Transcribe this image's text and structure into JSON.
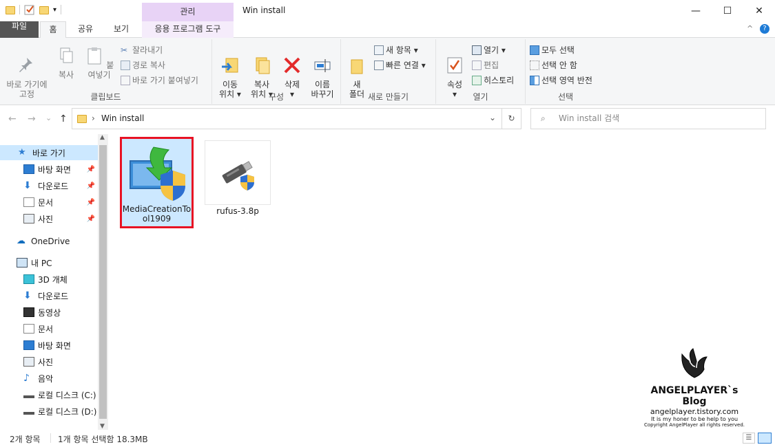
{
  "window": {
    "title": "Win install",
    "context_tab": "관리",
    "minimize": "—",
    "maximize": "☐",
    "close": "✕"
  },
  "tabs": {
    "file": "파일",
    "home": "홈",
    "share": "공유",
    "view": "보기",
    "app_tools": "응용 프로그램 도구"
  },
  "ribbon": {
    "clipboard": {
      "label": "클립보드",
      "pin": "바로 가기에\n고정",
      "copy": "복사",
      "paste": "붙여넣기",
      "cut": "잘라내기",
      "copy_path": "경로 복사",
      "paste_shortcut": "바로 가기 붙여넣기"
    },
    "organize": {
      "label": "구성",
      "move": "이동\n위치 ▾",
      "copy_to": "복사\n위치 ▾",
      "delete": "삭제\n▾",
      "rename": "이름\n바꾸기"
    },
    "new": {
      "label": "새로 만들기",
      "new_folder": "새\n폴더",
      "new_item": "새 항목 ▾",
      "easy_access": "빠른 연결 ▾"
    },
    "open": {
      "label": "열기",
      "properties": "속성\n▾",
      "open": "열기 ▾",
      "edit": "편집",
      "history": "히스토리"
    },
    "select": {
      "label": "선택",
      "select_all": "모두 선택",
      "select_none": "선택 안 함",
      "invert": "선택 영역 반전"
    }
  },
  "address": {
    "back": "←",
    "forward": "→",
    "recent": "⌄",
    "up": "↑",
    "path": "Win install",
    "refresh": "↻",
    "search_placeholder": "Win install 검색"
  },
  "nav": {
    "quick_access": "바로 가기",
    "quick_items": [
      "바탕 화면",
      "다운로드",
      "문서",
      "사진"
    ],
    "onedrive": "OneDrive",
    "this_pc": "내 PC",
    "pc_items": [
      "3D 개체",
      "다운로드",
      "동영상",
      "문서",
      "바탕 화면",
      "사진",
      "음악",
      "로컬 디스크 (C:)",
      "로컬 디스크 (D:)"
    ]
  },
  "files": [
    {
      "name": "MediaCreationTo\nol1909",
      "icon": "media-creation-tool-icon",
      "selected": true
    },
    {
      "name": "rufus-3.8p",
      "icon": "usb-drive-icon",
      "selected": false
    }
  ],
  "status": {
    "count": "2개 항목",
    "selection": "1개 항목 선택함 18.3MB"
  },
  "watermark": {
    "title": "ANGELPLAYER`s Blog",
    "url": "angelplayer.tistory.com",
    "tagline": "It is my honer to be help to you",
    "copyright": "Copyright AngelPlayer all rights reserved."
  },
  "colors": {
    "selection": "#cce8ff",
    "highlight_border": "#e81123",
    "context_tab": "#e8d3f6",
    "file_tab": "#555555"
  }
}
